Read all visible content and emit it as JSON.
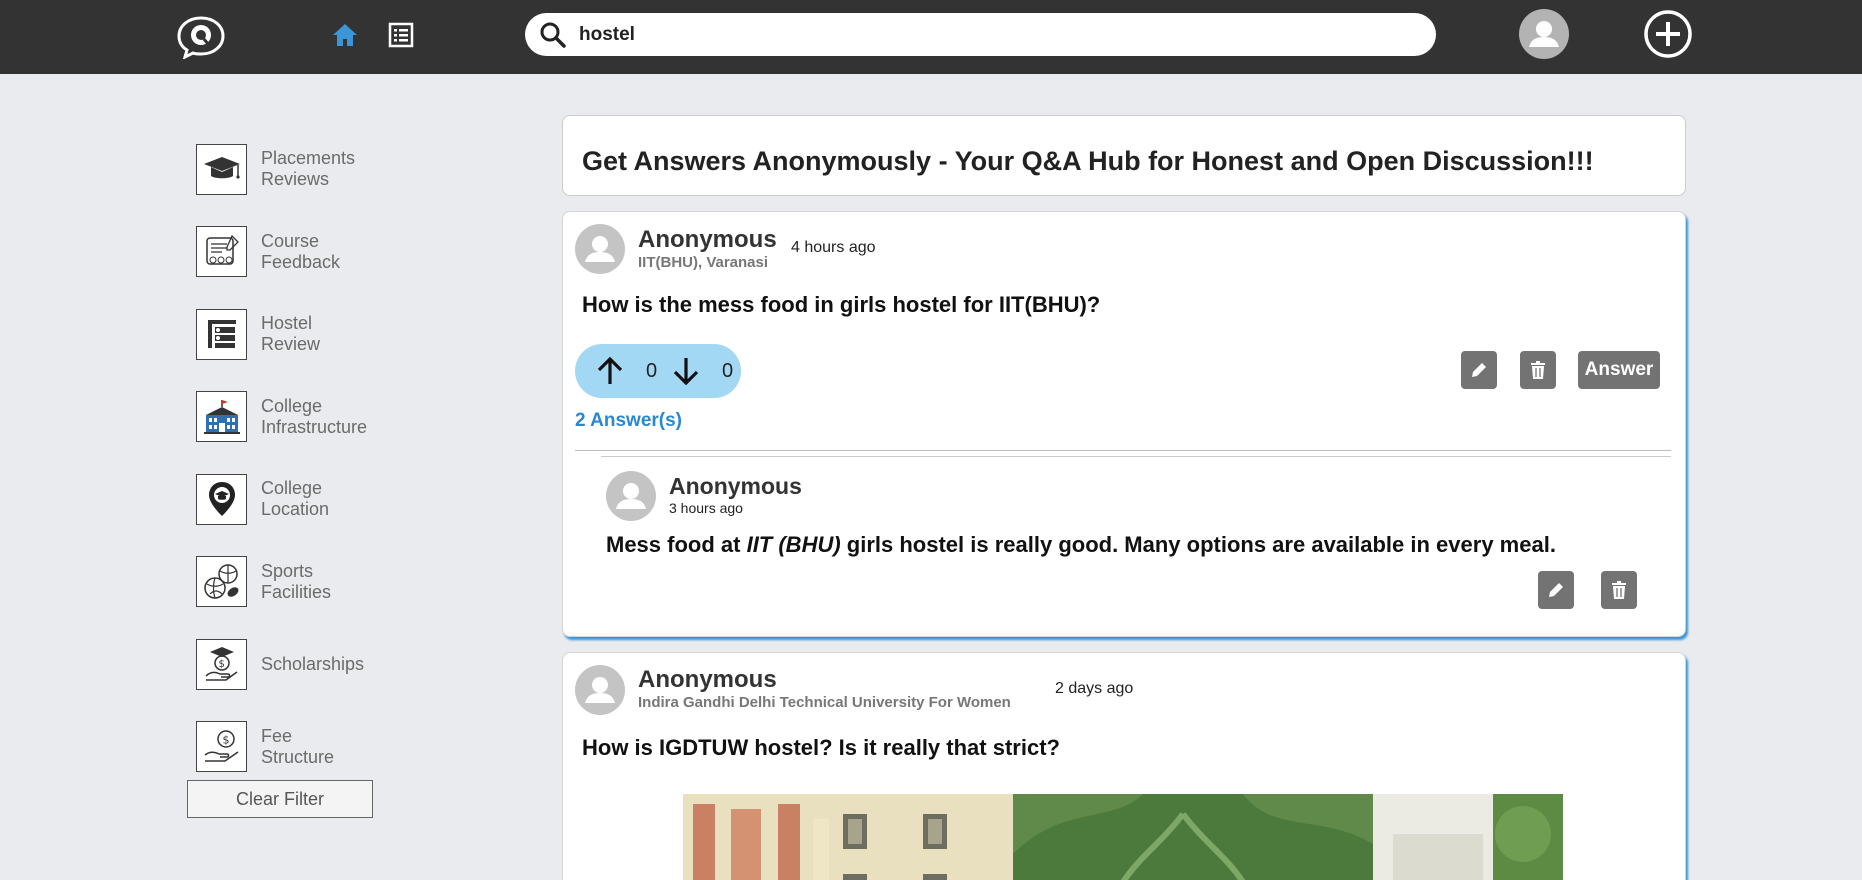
{
  "search": {
    "value": "hostel",
    "icon": "search-icon"
  },
  "sidebar": {
    "items": [
      {
        "label_line1": "Placements",
        "label_line2": "Reviews",
        "icon": "graduation-cap-icon"
      },
      {
        "label_line1": "Course",
        "label_line2": "Feedback",
        "icon": "feedback-form-icon"
      },
      {
        "label_line1": "Hostel",
        "label_line2": "Review",
        "icon": "hostel-bed-icon"
      },
      {
        "label_line1": "College",
        "label_line2": "Infrastructure",
        "icon": "college-building-icon"
      },
      {
        "label_line1": "College",
        "label_line2": "Location",
        "icon": "location-pin-icon"
      },
      {
        "label_line1": "Sports",
        "label_line2": "Facilities",
        "icon": "sports-balls-icon"
      },
      {
        "label_line1": "Scholarships",
        "label_line2": "",
        "icon": "scholarship-icon"
      },
      {
        "label_line1": "Fee",
        "label_line2": "Structure",
        "icon": "fee-hand-icon"
      }
    ],
    "clear_filter": "Clear Filter"
  },
  "hero": {
    "title": "Get Answers Anonymously - Your Q&A Hub for Honest and Open Discussion!!!"
  },
  "posts": [
    {
      "author": "Anonymous",
      "affiliation": "IIT(BHU), Varanasi",
      "time": "4 hours ago",
      "question": "How is the mess food in girls hostel for IIT(BHU)?",
      "upvotes": "0",
      "downvotes": "0",
      "answer_label": "Answer",
      "answers_count_label": "2 Answer(s)",
      "answers": [
        {
          "author": "Anonymous",
          "time": "3 hours ago",
          "text_before": "Mess food at ",
          "text_italic": "IIT (BHU)",
          "text_after": " girls hostel is really good. Many options are available in every meal."
        }
      ]
    },
    {
      "author": "Anonymous",
      "affiliation": "Indira Gandhi Delhi Technical University For Women",
      "time": "2 days ago",
      "question": "How is IGDTUW hostel? Is it really that strict?"
    }
  ],
  "colors": {
    "topbar": "#333333",
    "page_bg": "#e9ebee",
    "accent_blue": "#2a88d0",
    "vote_bg": "#a3d8f5",
    "button_grey": "#737373"
  }
}
